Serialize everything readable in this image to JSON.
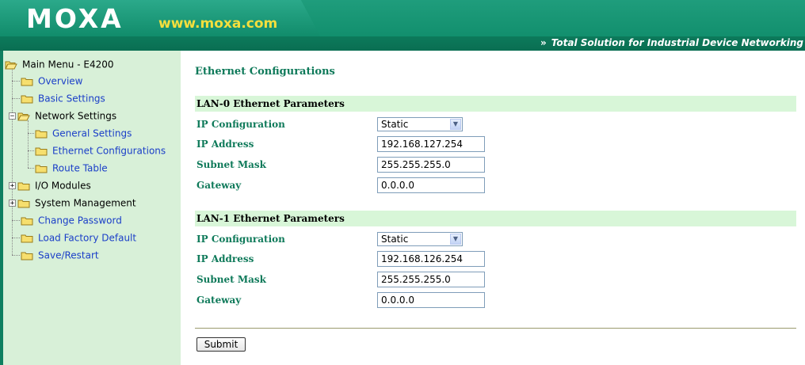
{
  "header": {
    "logo": "MOXA",
    "url": "www.moxa.com",
    "tagline": "Total Solution for Industrial Device Networking",
    "tagline_prefix": "»",
    "colors": {
      "header_green": "#0d8a68",
      "url_yellow": "#f5df3d"
    }
  },
  "sidebar": {
    "root": "Main Menu - E4200",
    "items": [
      {
        "label": "Overview"
      },
      {
        "label": "Basic Settings"
      },
      {
        "label": "Network Settings",
        "expander": "−"
      },
      {
        "label": "General Settings"
      },
      {
        "label": "Ethernet Configurations"
      },
      {
        "label": "Route Table"
      },
      {
        "label": "I/O Modules",
        "expander": "+"
      },
      {
        "label": "System Management",
        "expander": "+"
      },
      {
        "label": "Change Password"
      },
      {
        "label": "Load Factory Default"
      },
      {
        "label": "Save/Restart"
      }
    ]
  },
  "main": {
    "title": "Ethernet Configurations",
    "lan0": {
      "heading": "LAN-0 Ethernet Parameters",
      "ip_config_label": "IP Configuration",
      "ip_config_value": "Static",
      "ip_address_label": "IP Address",
      "ip_address_value": "192.168.127.254",
      "subnet_label": "Subnet Mask",
      "subnet_value": "255.255.255.0",
      "gateway_label": "Gateway",
      "gateway_value": "0.0.0.0"
    },
    "lan1": {
      "heading": "LAN-1 Ethernet Parameters",
      "ip_config_label": "IP Configuration",
      "ip_config_value": "Static",
      "ip_address_label": "IP Address",
      "ip_address_value": "192.168.126.254",
      "subnet_label": "Subnet Mask",
      "subnet_value": "255.255.255.0",
      "gateway_label": "Gateway",
      "gateway_value": "0.0.0.0"
    },
    "submit_label": "Submit"
  }
}
